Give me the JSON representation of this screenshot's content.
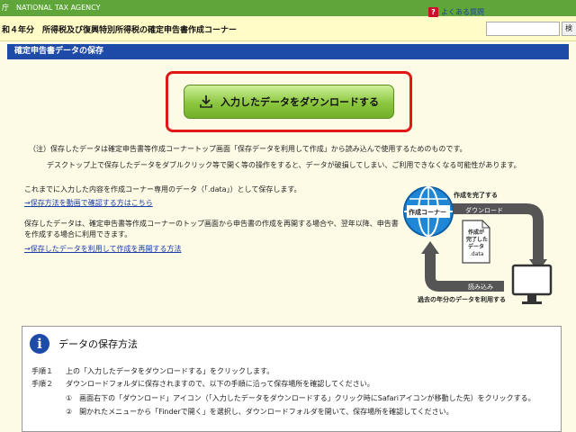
{
  "header": {
    "agency_fragment": "庁",
    "agency_name": "NATIONAL TAX AGENCY",
    "corner_title": "和４年分　所得税及び復興特別所得税の確定申告書作成コーナー",
    "faq_icon": "?",
    "faq_label": "よくある質問",
    "search_value": "",
    "search_button": "検"
  },
  "section": {
    "title": "確定申告書データの保存"
  },
  "download_button": {
    "label": "入力したデータをダウンロードする",
    "icon": "download-icon"
  },
  "notes": {
    "note1": "（注）保存したデータは確定申告書等作成コーナートップ画面「保存データを利用して作成」から読み込んで使用するためのものです。",
    "note2": "デスクトップ上で保存したデータをダブルクリック等で開く等の操作をすると、データが破損してしまい、ご利用できなくなる可能性があります。"
  },
  "body": {
    "para1": "これまでに入力した内容を作成コーナー専用のデータ（「.data」）として保存します。",
    "link1": "→保存方法を動画で確認する方はこちら",
    "para2": "保存したデータは、確定申告書等作成コーナーのトップ画面から申告書の作成を再開する場合や、翌年以降、申告書を作成する場合に利用できます。",
    "link2": "→保存したデータを利用して作成を再開する方法"
  },
  "illustration": {
    "complete_label": "作成を完了する",
    "download_label": "ダウンロード",
    "globe_label": "作成コーナー",
    "doc_line1": "作成が",
    "doc_line2": "完了した",
    "doc_line3": "データ",
    "doc_line4": ".data",
    "read_label": "読み込み",
    "past_label": "過去の年分のデータを利用する"
  },
  "howto": {
    "title": "データの保存方法",
    "step1_head": "手順１",
    "step1_text": "上の「入力したデータをダウンロードする」をクリックします。",
    "step2_head": "手順２",
    "step2_text": "ダウンロードフォルダに保存されますので、以下の手順に沿って保存場所を確認してください。",
    "sub1": "①　画面右下の「ダウンロード」アイコン（「入力したデータをダウンロードする」クリック時にSafariアイコンが移動した先）をクリックする。",
    "sub2": "②　開かれたメニューから「Finderで開く」を選択し、ダウンロードフォルダを開いて、保存場所を確認してください。"
  },
  "colors": {
    "topbar": "#5fa53a",
    "section_header": "#1e4aa8",
    "button_green": "#8cc63f",
    "highlight_red": "#e01818",
    "link": "#1a3da8",
    "background": "#fdfbe6"
  }
}
